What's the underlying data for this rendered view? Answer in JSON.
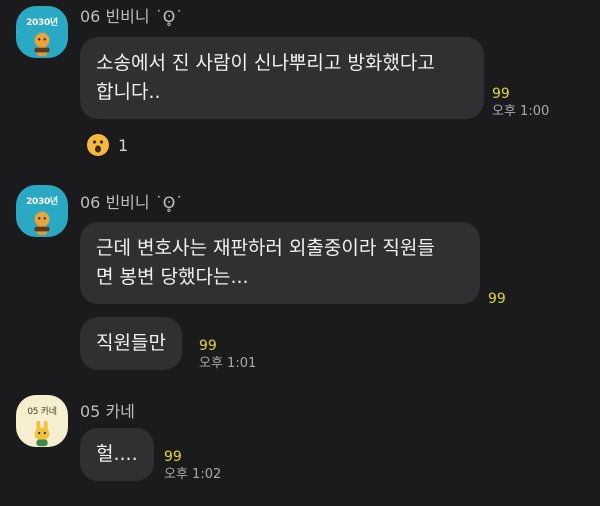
{
  "messages": [
    {
      "sender": "06 빈비니 ˙ʘ̥˙",
      "avatar_label": "2030년",
      "lines": [
        "소송에서 진 사람이 신나뿌리고 방화했다고",
        "합니다.."
      ],
      "unread": "99",
      "time": "오후 1:00",
      "reaction": {
        "icon": "surprised-face-emoji",
        "count": "1"
      }
    },
    {
      "sender": "06 빈비니 ˙ʘ̥˙",
      "avatar_label": "2030년",
      "lines": [
        "근데 변호사는 재판하러 외출중이라 직원들",
        "면 봉변 당했다는..."
      ],
      "unread": "99"
    },
    {
      "lines": [
        "직원들만"
      ],
      "unread": "99",
      "time": "오후 1:01"
    },
    {
      "sender": "05 카네",
      "avatar_label": "05 카네",
      "lines": [
        "헐...."
      ],
      "unread": "99",
      "time": "오후 1:02"
    }
  ],
  "colors": {
    "background": "#1b1b1d",
    "bubble": "#303033",
    "unread": "#dcd63c",
    "avatar_teal": "#2aa9c4",
    "avatar_cream": "#f6efcf"
  }
}
